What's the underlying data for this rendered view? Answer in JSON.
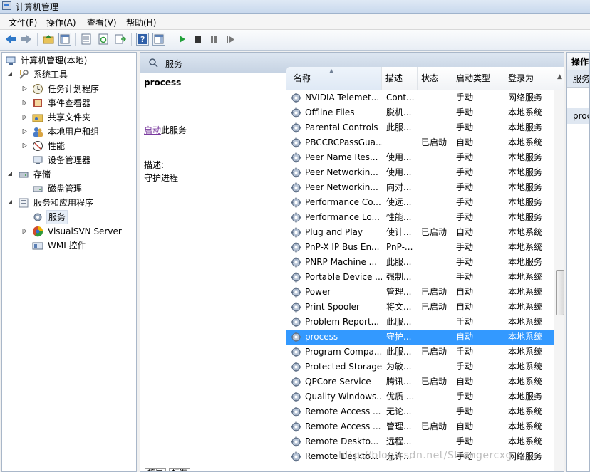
{
  "window": {
    "title": "计算机管理"
  },
  "menu": [
    "文件(F)",
    "操作(A)",
    "查看(V)",
    "帮助(H)"
  ],
  "toolbar": {
    "buttons": [
      "back-icon",
      "forward-icon",
      "up-folder-icon",
      "show-hide-tree-icon",
      "properties-icon",
      "refresh-icon",
      "export-list-icon",
      "help-icon",
      "show-action-pane-icon",
      "start-icon",
      "stop-icon",
      "pause-icon",
      "restart-icon"
    ]
  },
  "tree": {
    "items": [
      {
        "label": "计算机管理(本地)",
        "icon": "computer-management-icon",
        "level": 0,
        "expander": "none"
      },
      {
        "label": "系统工具",
        "icon": "tools-icon",
        "level": 1,
        "expander": "expanded"
      },
      {
        "label": "任务计划程序",
        "icon": "clock-icon",
        "level": 2,
        "expander": "collapsed"
      },
      {
        "label": "事件查看器",
        "icon": "event-viewer-icon",
        "level": 2,
        "expander": "collapsed"
      },
      {
        "label": "共享文件夹",
        "icon": "shared-folder-icon",
        "level": 2,
        "expander": "collapsed"
      },
      {
        "label": "本地用户和组",
        "icon": "users-icon",
        "level": 2,
        "expander": "collapsed"
      },
      {
        "label": "性能",
        "icon": "performance-icon",
        "level": 2,
        "expander": "collapsed"
      },
      {
        "label": "设备管理器",
        "icon": "device-manager-icon",
        "level": 2,
        "expander": "none"
      },
      {
        "label": "存储",
        "icon": "storage-icon",
        "level": 1,
        "expander": "expanded"
      },
      {
        "label": "磁盘管理",
        "icon": "disk-icon",
        "level": 2,
        "expander": "none"
      },
      {
        "label": "服务和应用程序",
        "icon": "services-apps-icon",
        "level": 1,
        "expander": "expanded"
      },
      {
        "label": "服务",
        "icon": "gear-icon",
        "level": 2,
        "expander": "none",
        "selected": true
      },
      {
        "label": "VisualSVN Server",
        "icon": "visualsvn-icon",
        "level": 2,
        "expander": "collapsed"
      },
      {
        "label": "WMI 控件",
        "icon": "wmi-icon",
        "level": 2,
        "expander": "none"
      }
    ]
  },
  "center": {
    "header_title": "服务",
    "detail": {
      "service_name": "process",
      "start_link": "启动",
      "start_suffix": "此服务",
      "desc_label": "描述:",
      "desc_text": "守护进程"
    },
    "columns": [
      "名称",
      "描述",
      "状态",
      "启动类型",
      "登录为"
    ],
    "rows": [
      [
        "NVIDIA Telemet...",
        "Cont...",
        "",
        "手动",
        "网络服务"
      ],
      [
        "Offline Files",
        "脱机...",
        "",
        "手动",
        "本地系统"
      ],
      [
        "Parental Controls",
        "此服...",
        "",
        "手动",
        "本地服务"
      ],
      [
        "PBCCRCPassGua...",
        "",
        "已启动",
        "自动",
        "本地系统"
      ],
      [
        "Peer Name Res...",
        "使用...",
        "",
        "手动",
        "本地服务"
      ],
      [
        "Peer Networkin...",
        "使用...",
        "",
        "手动",
        "本地服务"
      ],
      [
        "Peer Networkin...",
        "向对...",
        "",
        "手动",
        "本地服务"
      ],
      [
        "Performance Co...",
        "使远...",
        "",
        "手动",
        "本地服务"
      ],
      [
        "Performance Lo...",
        "性能...",
        "",
        "手动",
        "本地服务"
      ],
      [
        "Plug and Play",
        "使计...",
        "已启动",
        "自动",
        "本地系统"
      ],
      [
        "PnP-X IP Bus En...",
        "PnP-...",
        "",
        "手动",
        "本地系统"
      ],
      [
        "PNRP Machine ...",
        "此服...",
        "",
        "手动",
        "本地服务"
      ],
      [
        "Portable Device ...",
        "强制...",
        "",
        "手动",
        "本地系统"
      ],
      [
        "Power",
        "管理...",
        "已启动",
        "自动",
        "本地系统"
      ],
      [
        "Print Spooler",
        "将文...",
        "已启动",
        "自动",
        "本地系统"
      ],
      [
        "Problem Report...",
        "此服...",
        "",
        "手动",
        "本地系统"
      ],
      [
        "process",
        "守护...",
        "",
        "自动",
        "本地系统"
      ],
      [
        "Program Compa...",
        "此服...",
        "已启动",
        "手动",
        "本地系统"
      ],
      [
        "Protected Storage",
        "为敏...",
        "",
        "手动",
        "本地系统"
      ],
      [
        "QPCore Service",
        "腾讯...",
        "已启动",
        "自动",
        "本地系统"
      ],
      [
        "Quality Windows...",
        "优质 ...",
        "",
        "手动",
        "本地服务"
      ],
      [
        "Remote Access ...",
        "无论...",
        "",
        "手动",
        "本地系统"
      ],
      [
        "Remote Access ...",
        "管理...",
        "已启动",
        "自动",
        "本地系统"
      ],
      [
        "Remote Deskto...",
        "远程...",
        "",
        "手动",
        "本地系统"
      ],
      [
        "Remote Deskto...",
        "允许...",
        "",
        "手动",
        "网络服务"
      ]
    ],
    "selected_row": 16,
    "tabs": [
      "扩展",
      "标准"
    ]
  },
  "actions": {
    "header": "操作",
    "item1": "服务",
    "item2": "proc"
  },
  "watermark": "http://blog.csdn.net/Strangercxg",
  "colors": {
    "selection": "#3399ff",
    "link": "#7a3a9e",
    "header_band": "#c6d3e3"
  }
}
